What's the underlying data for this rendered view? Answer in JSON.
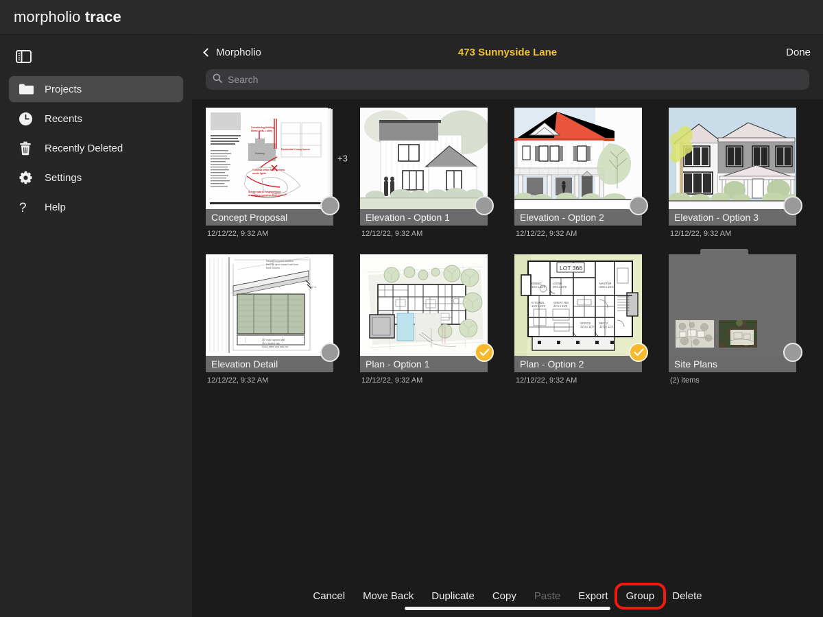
{
  "app": {
    "brand_light": "morpholio",
    "brand_bold": "trace"
  },
  "sidebar": {
    "toggle_icon": "sidebar-toggle-icon",
    "items": [
      {
        "label": "Projects",
        "icon": "folder-icon",
        "active": true
      },
      {
        "label": "Recents",
        "icon": "clock-icon",
        "active": false
      },
      {
        "label": "Recently Deleted",
        "icon": "trash-icon",
        "active": false
      },
      {
        "label": "Settings",
        "icon": "gear-icon",
        "active": false
      },
      {
        "label": "Help",
        "icon": "question-icon",
        "active": false
      }
    ]
  },
  "navbar": {
    "back_label": "Morpholio",
    "title": "473 Sunnyside Lane",
    "title_color": "#f2c230",
    "done_label": "Done"
  },
  "search": {
    "placeholder": "Search",
    "value": "",
    "icon": "search-icon"
  },
  "grid": {
    "items": [
      {
        "name": "Concept Proposal",
        "meta": "12/12/22, 9:32 AM",
        "type": "stack",
        "stack_count": "+3",
        "selected": false,
        "art": "concept-proposal-sheet"
      },
      {
        "name": "Elevation - Option 1",
        "meta": "12/12/22, 9:32 AM",
        "type": "sheet",
        "selected": false,
        "art": "elevation-option-1-render"
      },
      {
        "name": "Elevation - Option 2",
        "meta": "12/12/22, 9:32 AM",
        "type": "sheet",
        "selected": false,
        "art": "elevation-option-2-render"
      },
      {
        "name": "Elevation - Option 3",
        "meta": "12/12/22, 9:32 AM",
        "type": "sheet",
        "selected": false,
        "art": "elevation-option-3-render"
      },
      {
        "name": "Elevation Detail",
        "meta": "12/12/22, 9:32 AM",
        "type": "sheet",
        "selected": false,
        "art": "elevation-detail-drawing"
      },
      {
        "name": "Plan - Option 1",
        "meta": "12/12/22, 9:32 AM",
        "type": "sheet",
        "selected": true,
        "art": "plan-option-1-siteplan"
      },
      {
        "name": "Plan - Option 2",
        "meta": "12/12/22, 9:32 AM",
        "type": "sheet",
        "selected": true,
        "art": "plan-option-2-floorplan"
      },
      {
        "name": "Site Plans",
        "meta": "(2) items",
        "type": "folder",
        "selected": false,
        "art": "site-plans-folder"
      }
    ]
  },
  "toolbar": {
    "buttons": [
      {
        "label": "Cancel",
        "state": "normal"
      },
      {
        "label": "Move Back",
        "state": "normal"
      },
      {
        "label": "Duplicate",
        "state": "normal"
      },
      {
        "label": "Copy",
        "state": "normal"
      },
      {
        "label": "Paste",
        "state": "disabled"
      },
      {
        "label": "Export",
        "state": "normal"
      },
      {
        "label": "Group",
        "state": "highlighted"
      },
      {
        "label": "Delete",
        "state": "normal"
      }
    ],
    "highlight_color": "#f01b0e"
  }
}
